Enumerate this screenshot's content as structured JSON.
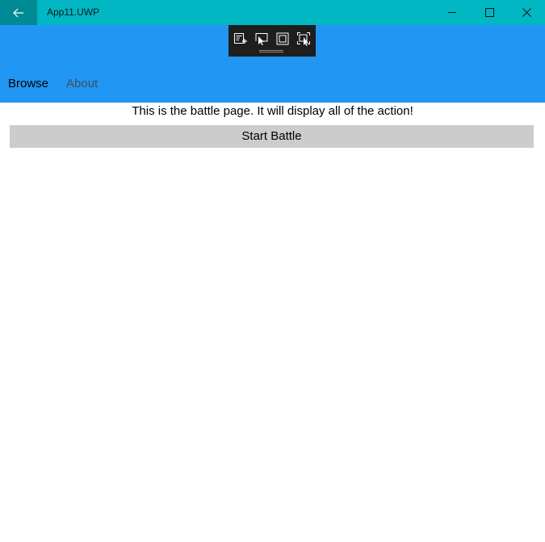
{
  "window": {
    "title": "App11.UWP",
    "back_icon": "back-arrow-icon",
    "controls": [
      "minimize-icon",
      "maximize-icon",
      "close-icon"
    ]
  },
  "dev_toolbar": {
    "icons": [
      "live-visual-tree-icon",
      "select-element-icon",
      "display-layout-adorners-icon",
      "track-focused-element-icon"
    ]
  },
  "nav": {
    "tabs": [
      {
        "label": "Browse",
        "selected": true
      },
      {
        "label": "About",
        "selected": false
      }
    ]
  },
  "main": {
    "description": "This is the battle page. It will display all of the action!",
    "start_button_label": "Start Battle"
  },
  "colors": {
    "title_bar": "#00b7c3",
    "back_button": "#008a93",
    "header": "#2196f3",
    "button": "#cccccc"
  }
}
